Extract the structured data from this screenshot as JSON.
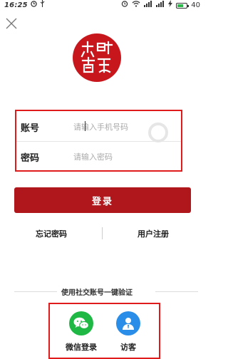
{
  "status_bar": {
    "time": "16:25",
    "battery": "40",
    "left_icons": [
      "clock-icon",
      "usb-icon"
    ],
    "right_icons": [
      "alarm-icon",
      "wifi-icon",
      "signal-icon",
      "signal-icon",
      "charging-icon",
      "battery-icon"
    ]
  },
  "close": {
    "icon": "close-icon"
  },
  "logo": {
    "text": "华时商代",
    "color": "#c8161d"
  },
  "form": {
    "account_label": "账号",
    "account_placeholder": "请输入手机号码",
    "password_label": "密码",
    "password_placeholder": "请输入密码"
  },
  "login_button": {
    "label": "登录",
    "color": "#b0171d"
  },
  "links": {
    "forgot": "忘记密码",
    "register": "用户注册"
  },
  "third_party": {
    "title": "使用社交账号一键验证",
    "wechat_label": "微信登录",
    "guest_label": "访客",
    "wechat_color": "#1fb845",
    "guest_color": "#2a8de8"
  },
  "highlight_color": "#e01b1b"
}
